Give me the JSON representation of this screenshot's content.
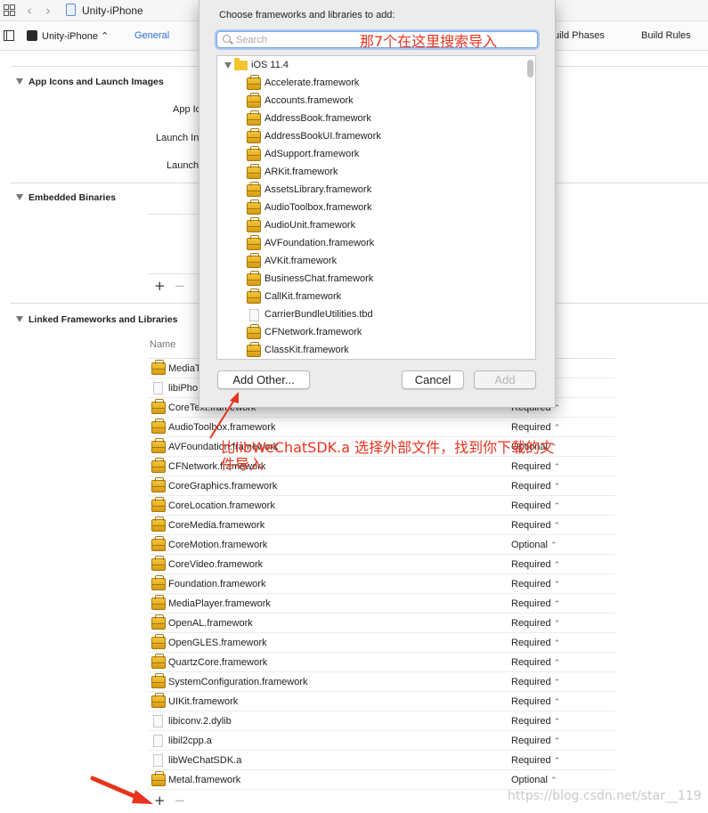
{
  "window": {
    "title": "Unity-iPhone"
  },
  "toolbar": {
    "target": "Unity-iPhone ⌃",
    "tabs": [
      {
        "label": "General"
      },
      {
        "label": "uild Phases"
      },
      {
        "label": "Build Rules"
      }
    ]
  },
  "sections": {
    "app_icons": {
      "label": "App Icons and Launch Images",
      "fields": [
        "App Ic",
        "Launch In",
        "Launch"
      ]
    },
    "embedded": {
      "label": "Embedded Binaries"
    },
    "linked": {
      "label": "Linked Frameworks and Libraries",
      "column_name": "Name"
    }
  },
  "controls": {
    "plus": "+",
    "minus": "−"
  },
  "linked_rows": [
    {
      "name": "MediaT",
      "status": "",
      "icon": "framework-icon"
    },
    {
      "name": "libiPho",
      "status": "",
      "icon": "document-icon"
    },
    {
      "name": "CoreText.framework",
      "status": "Required",
      "icon": "framework-icon"
    },
    {
      "name": "AudioToolbox.framework",
      "status": "Required",
      "icon": "framework-icon"
    },
    {
      "name": "AVFoundation.framework",
      "status": "Optional",
      "icon": "framework-icon"
    },
    {
      "name": "CFNetwork.framework",
      "status": "Required",
      "icon": "framework-icon"
    },
    {
      "name": "CoreGraphics.framework",
      "status": "Required",
      "icon": "framework-icon"
    },
    {
      "name": "CoreLocation.framework",
      "status": "Required",
      "icon": "framework-icon"
    },
    {
      "name": "CoreMedia.framework",
      "status": "Required",
      "icon": "framework-icon"
    },
    {
      "name": "CoreMotion.framework",
      "status": "Optional",
      "icon": "framework-icon"
    },
    {
      "name": "CoreVideo.framework",
      "status": "Required",
      "icon": "framework-icon"
    },
    {
      "name": "Foundation.framework",
      "status": "Required",
      "icon": "framework-icon"
    },
    {
      "name": "MediaPlayer.framework",
      "status": "Required",
      "icon": "framework-icon"
    },
    {
      "name": "OpenAL.framework",
      "status": "Required",
      "icon": "framework-icon"
    },
    {
      "name": "OpenGLES.framework",
      "status": "Required",
      "icon": "framework-icon"
    },
    {
      "name": "QuartzCore.framework",
      "status": "Required",
      "icon": "framework-icon"
    },
    {
      "name": "SystemConfiguration.framework",
      "status": "Required",
      "icon": "framework-icon"
    },
    {
      "name": "UIKit.framework",
      "status": "Required",
      "icon": "framework-icon"
    },
    {
      "name": "libiconv.2.dylib",
      "status": "Required",
      "icon": "document-icon"
    },
    {
      "name": "libil2cpp.a",
      "status": "Required",
      "icon": "document-icon"
    },
    {
      "name": "libWeChatSDK.a",
      "status": "Required",
      "icon": "document-icon"
    },
    {
      "name": "Metal.framework",
      "status": "Optional",
      "icon": "framework-icon"
    }
  ],
  "dialog": {
    "title": "Choose frameworks and libraries to add:",
    "search_placeholder": "Search",
    "sdk_folder": "iOS 11.4",
    "items": [
      {
        "name": "Accelerate.framework",
        "icon": "framework-icon"
      },
      {
        "name": "Accounts.framework",
        "icon": "framework-icon"
      },
      {
        "name": "AddressBook.framework",
        "icon": "framework-icon"
      },
      {
        "name": "AddressBookUI.framework",
        "icon": "framework-icon"
      },
      {
        "name": "AdSupport.framework",
        "icon": "framework-icon"
      },
      {
        "name": "ARKit.framework",
        "icon": "framework-icon"
      },
      {
        "name": "AssetsLibrary.framework",
        "icon": "framework-icon"
      },
      {
        "name": "AudioToolbox.framework",
        "icon": "framework-icon"
      },
      {
        "name": "AudioUnit.framework",
        "icon": "framework-icon"
      },
      {
        "name": "AVFoundation.framework",
        "icon": "framework-icon"
      },
      {
        "name": "AVKit.framework",
        "icon": "framework-icon"
      },
      {
        "name": "BusinessChat.framework",
        "icon": "framework-icon"
      },
      {
        "name": "CallKit.framework",
        "icon": "framework-icon"
      },
      {
        "name": "CarrierBundleUtilities.tbd",
        "icon": "document-icon"
      },
      {
        "name": "CFNetwork.framework",
        "icon": "framework-icon"
      },
      {
        "name": "ClassKit.framework",
        "icon": "framework-icon"
      }
    ],
    "buttons": {
      "add_other": "Add Other...",
      "cancel": "Cancel",
      "add": "Add"
    }
  },
  "annotations": {
    "search_hint": "那7个在这里搜索导入",
    "add_other_hint": "比libWeChatSDK.a 选择外部文件，找到你下载的文件导入",
    "color": "#e8331d"
  },
  "watermark": "https://blog.csdn.net/star__119"
}
